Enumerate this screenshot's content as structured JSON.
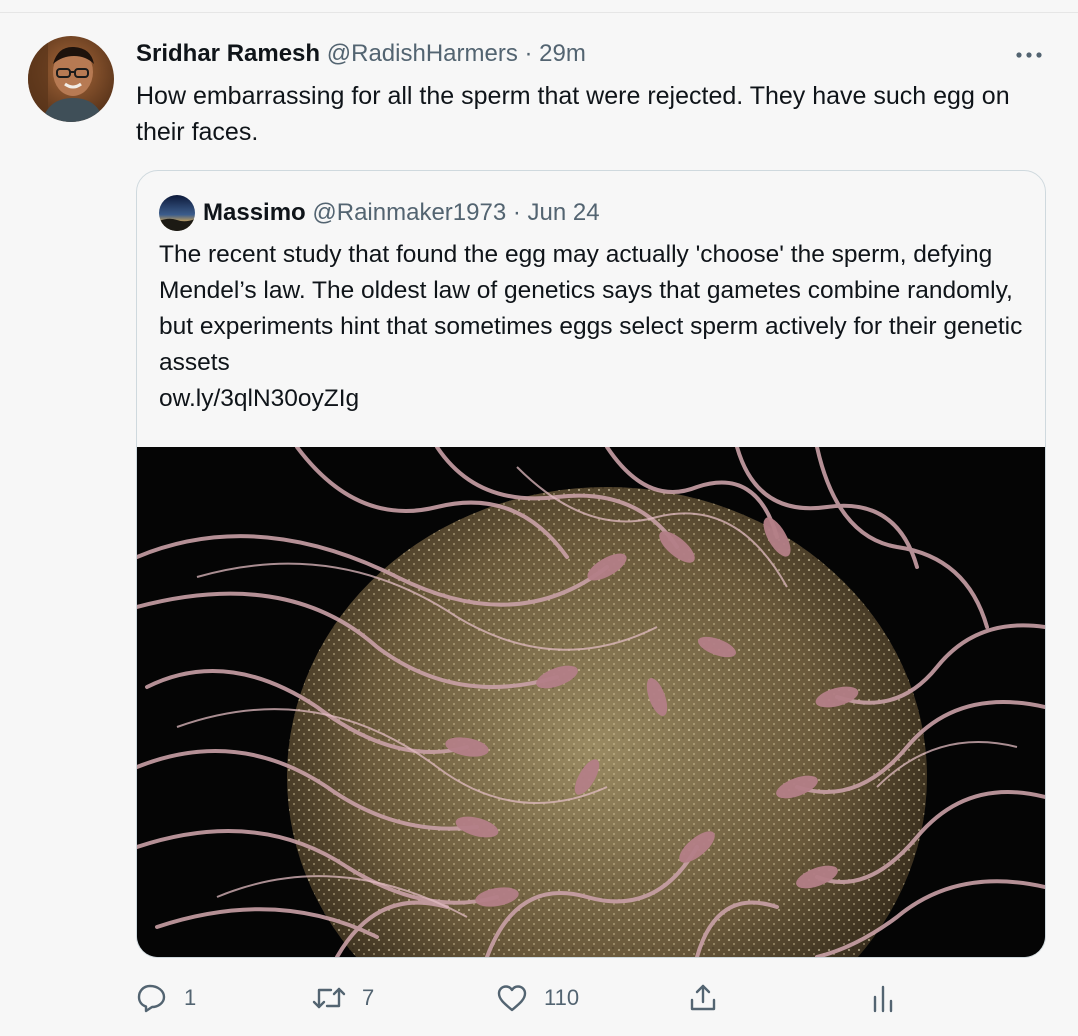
{
  "tweet": {
    "author_name": "Sridhar Ramesh",
    "handle": "@RadishHarmers",
    "separator": "·",
    "time": "29m",
    "text": "How embarrassing for all the sperm that were rejected. They have such egg on their faces.",
    "more_icon": "more-horizontal-icon"
  },
  "quoted_tweet": {
    "author_name": "Massimo",
    "handle": "@Rainmaker1973",
    "separator": "·",
    "date": "Jun 24",
    "text": "The recent study that found the egg may actually 'choose' the sperm, defying Mendel’s law. The oldest law of genetics says that gametes combine randomly, but experiments hint that sometimes eggs select sperm actively for their genetic assets",
    "link": "ow.ly/3qlN30oyZIg"
  },
  "actions": {
    "reply_count": "1",
    "retweet_count": "7",
    "like_count": "110",
    "reply_icon": "reply-icon",
    "retweet_icon": "retweet-icon",
    "like_icon": "heart-icon",
    "share_icon": "share-icon",
    "analytics_icon": "analytics-icon"
  },
  "colors": {
    "text_primary": "#0f1419",
    "text_secondary": "#536471",
    "border": "#cfd9de",
    "background": "#f7f7f7"
  }
}
